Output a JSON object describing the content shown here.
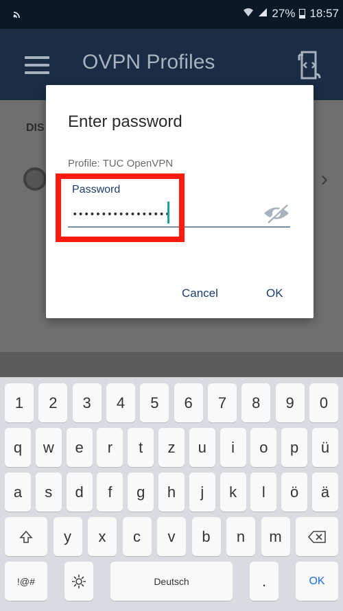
{
  "status_bar": {
    "left_icon": "cast-icon",
    "battery_percent": "27%",
    "time": "18:57"
  },
  "app_bar": {
    "title": "OVPN Profiles"
  },
  "background": {
    "status_fragment": "DIS",
    "chevron": "›"
  },
  "dialog": {
    "title": "Enter password",
    "profile_label": "Profile: TUC OpenVPN",
    "password_label": "Password",
    "password_value": "•••••••••••••••••",
    "cancel_label": "Cancel",
    "ok_label": "OK"
  },
  "keyboard": {
    "number_row": [
      "1",
      "2",
      "3",
      "4",
      "5",
      "6",
      "7",
      "8",
      "9",
      "0"
    ],
    "row1": [
      "q",
      "w",
      "e",
      "r",
      "t",
      "z",
      "u",
      "i",
      "o",
      "p",
      "ü"
    ],
    "row2": [
      "a",
      "s",
      "d",
      "f",
      "g",
      "h",
      "j",
      "k",
      "l",
      "ö",
      "ä"
    ],
    "row3": [
      "y",
      "x",
      "c",
      "v",
      "b",
      "n",
      "m"
    ],
    "symbols_key": "!@#",
    "space_label": "Deutsch",
    "period_key": ".",
    "enter_key": "OK"
  },
  "colors": {
    "app_bar": "#1a2d45",
    "status_bar": "#0b1826",
    "highlight": "#ff1a0e",
    "accent": "#1b3d6a",
    "caret": "#1aa39a"
  }
}
